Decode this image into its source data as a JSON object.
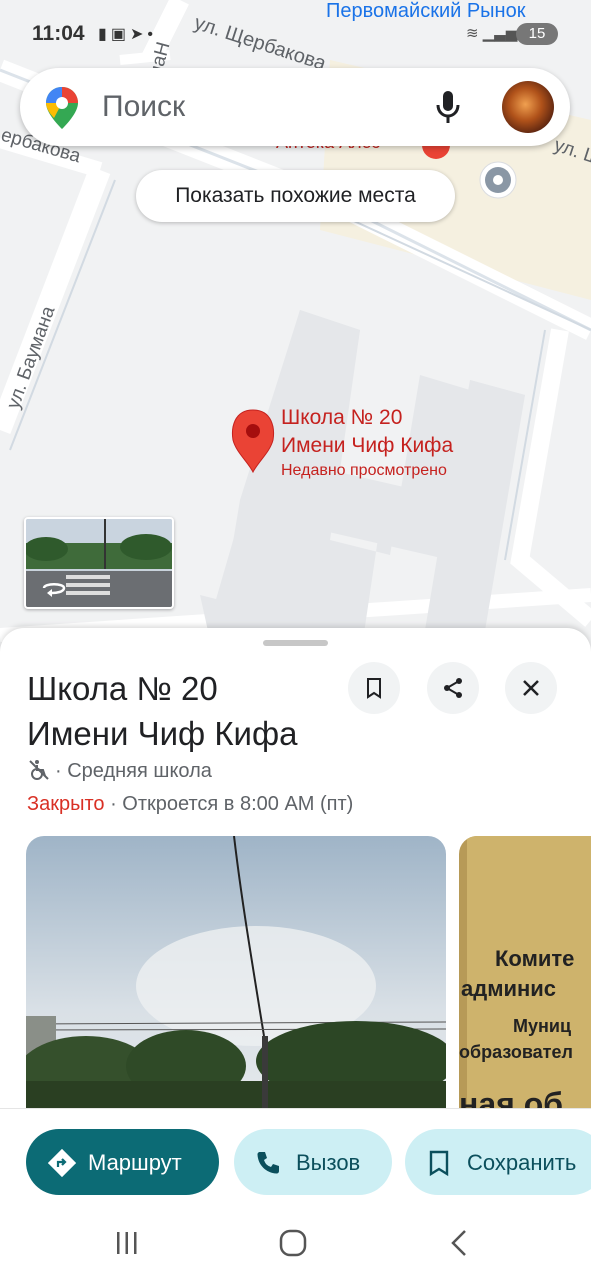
{
  "status_bar": {
    "time": "11:04",
    "battery": "15"
  },
  "map": {
    "top_place_label": "Первомайский Рынок",
    "streets": {
      "shcherbakova": "ул. Щербакова",
      "shcherbakova_left": "ербакова",
      "baumana": "ул. Баумана",
      "ul_right": "ул. Ш",
      "manh": "маН"
    },
    "pharmacy_label": "Аптека Алоэ",
    "place_name_line1": "Школа № 20",
    "place_name_line2": "Имени Чиф Кифа",
    "place_note": "Недавно просмотрено"
  },
  "search": {
    "placeholder": "Поиск"
  },
  "similar_chip": "Показать похожие места",
  "place": {
    "title_line1": "Школа № 20",
    "title_line2": "Имени Чиф Кифа",
    "category": "· Средняя школа",
    "status": "Закрыто",
    "hours": " · Откроется в 8:00 AM (пт)",
    "photo2_text": [
      "Комите",
      "админис",
      "Муниц",
      "образовател",
      "ная об"
    ]
  },
  "actions": {
    "route": "Маршрут",
    "call": "Вызов",
    "save": "Сохранить"
  },
  "colors": {
    "accent": "#0c6b75",
    "tonal": "#cdeff4",
    "closed": "#d93025",
    "pin": "#ea4335",
    "link": "#1a73e8"
  }
}
